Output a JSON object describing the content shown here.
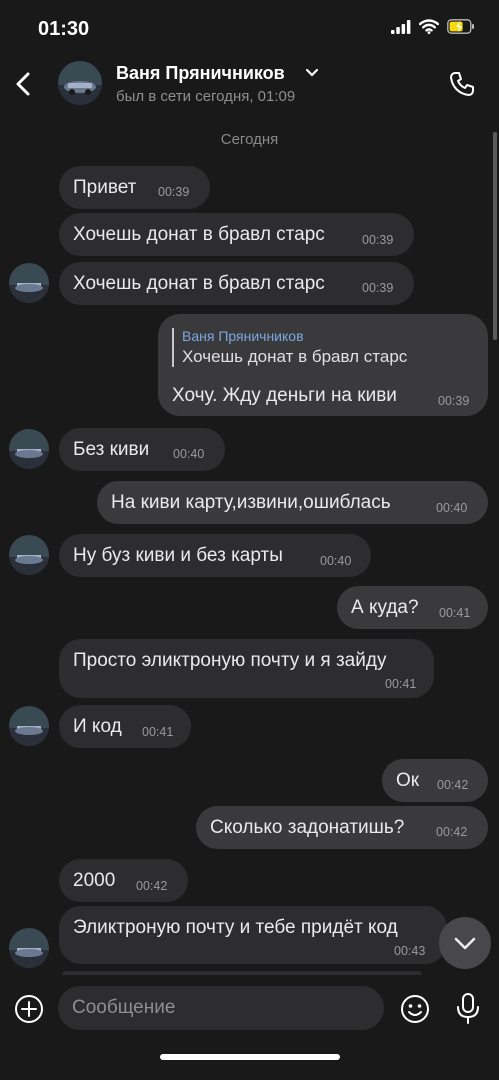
{
  "status_bar": {
    "time": "01:30",
    "battery_color": "#f5d90a"
  },
  "header": {
    "name": "Ваня Пряничников",
    "status": "был в сети сегодня, 01:09",
    "icons": [
      "back-chevron-icon",
      "chevron-down-icon",
      "phone-icon"
    ]
  },
  "date_separator": "Сегодня",
  "messages": [
    {
      "direction": "in",
      "text": "Привет",
      "time": "00:39"
    },
    {
      "direction": "in",
      "text": "Хочешь донат в бравл старс",
      "time": "00:39"
    },
    {
      "direction": "in",
      "text": "Хочешь донат в бравл старс",
      "time": "00:39"
    },
    {
      "direction": "out",
      "reply_name": "Ваня Пряничников",
      "reply_text": "Хочешь донат в бравл старс",
      "text": "Хочу. Жду деньги на киви",
      "time": "00:39"
    },
    {
      "direction": "in",
      "text": "Без киви",
      "time": "00:40"
    },
    {
      "direction": "out",
      "text": "На киви карту,извини,ошиблась",
      "time": "00:40"
    },
    {
      "direction": "in",
      "text": "Ну буз киви и без карты",
      "time": "00:40"
    },
    {
      "direction": "out",
      "text": "А куда?",
      "time": "00:41"
    },
    {
      "direction": "in",
      "text": "Просто эликтроную почту и я зайду",
      "time": "00:41"
    },
    {
      "direction": "in",
      "text": "И код",
      "time": "00:41"
    },
    {
      "direction": "out",
      "text": "Ок",
      "time": "00:42"
    },
    {
      "direction": "out",
      "text": "Сколько задонатишь?",
      "time": "00:42"
    },
    {
      "direction": "in",
      "text": "2000",
      "time": "00:42"
    },
    {
      "direction": "in",
      "text": "Эликтроную почту и тебе придёт код",
      "time": "00:43"
    }
  ],
  "composer": {
    "placeholder": "Сообщение",
    "icons": [
      "plus-icon",
      "emoji-icon",
      "microphone-icon"
    ]
  },
  "colors": {
    "background": "#191919",
    "bubble_in": "#2d2d2f",
    "bubble_out": "#3a3a3c",
    "reply_name": "#7da7e0"
  }
}
